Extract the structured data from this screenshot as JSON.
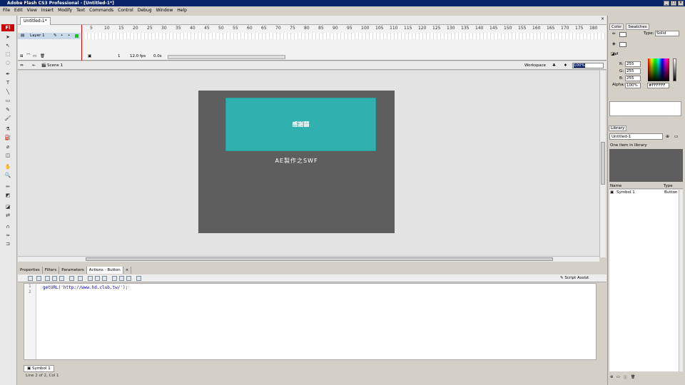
{
  "window": {
    "title": "Adobe Flash CS3 Professional - [Untitled-1*]"
  },
  "menu": [
    "File",
    "Edit",
    "View",
    "Insert",
    "Modify",
    "Text",
    "Commands",
    "Control",
    "Debug",
    "Window",
    "Help"
  ],
  "document": {
    "tab": "Untitled-1*"
  },
  "tools": {
    "logo": "Fl"
  },
  "timeline": {
    "layer_name": "Layer 1",
    "ruler": [
      "5",
      "10",
      "15",
      "20",
      "25",
      "30",
      "35",
      "40",
      "45",
      "50",
      "55",
      "60",
      "65",
      "70",
      "75",
      "80",
      "85",
      "90",
      "95",
      "100",
      "105",
      "110",
      "115",
      "120",
      "125",
      "130",
      "135",
      "140",
      "145",
      "150",
      "155",
      "160",
      "165",
      "170",
      "175",
      "180"
    ],
    "frame": "1",
    "fps": "12.0 fps",
    "time": "0.0s"
  },
  "edit_bar": {
    "scene": "Scene 1",
    "workspace": "Workspace",
    "zoom": "100%"
  },
  "stage": {
    "button_text": "感謝囍",
    "caption": "AE製作之SWF",
    "bg": "#5e5e5e",
    "button_color": "#31b0b0"
  },
  "panels": {
    "tabs": [
      "Properties",
      "Filters",
      "Parameters",
      "Actions - Button"
    ],
    "active": "Actions - Button",
    "script_assist": "Script Assist",
    "line_numbers": [
      "1",
      "2"
    ],
    "code": "getURL('http://www.hd.club.tw/');",
    "symbol_tab": "Symbol 1",
    "status": "Line 2 of 2, Col 1"
  },
  "color_panel": {
    "tabs": [
      "Color",
      "Swatches"
    ],
    "type_label": "Type:",
    "type_value": "Solid",
    "r_label": "R:",
    "r": "255",
    "g_label": "G:",
    "g": "255",
    "b_label": "B:",
    "b": "255",
    "alpha_label": "Alpha:",
    "alpha": "100%",
    "hex": "#FFFFFF"
  },
  "library": {
    "tab": "Library",
    "doc": "Untitled-1",
    "count": "One item in library",
    "col_name": "Name",
    "col_type": "Type",
    "items": [
      {
        "name": "Symbol 1",
        "type": "Button"
      }
    ]
  }
}
